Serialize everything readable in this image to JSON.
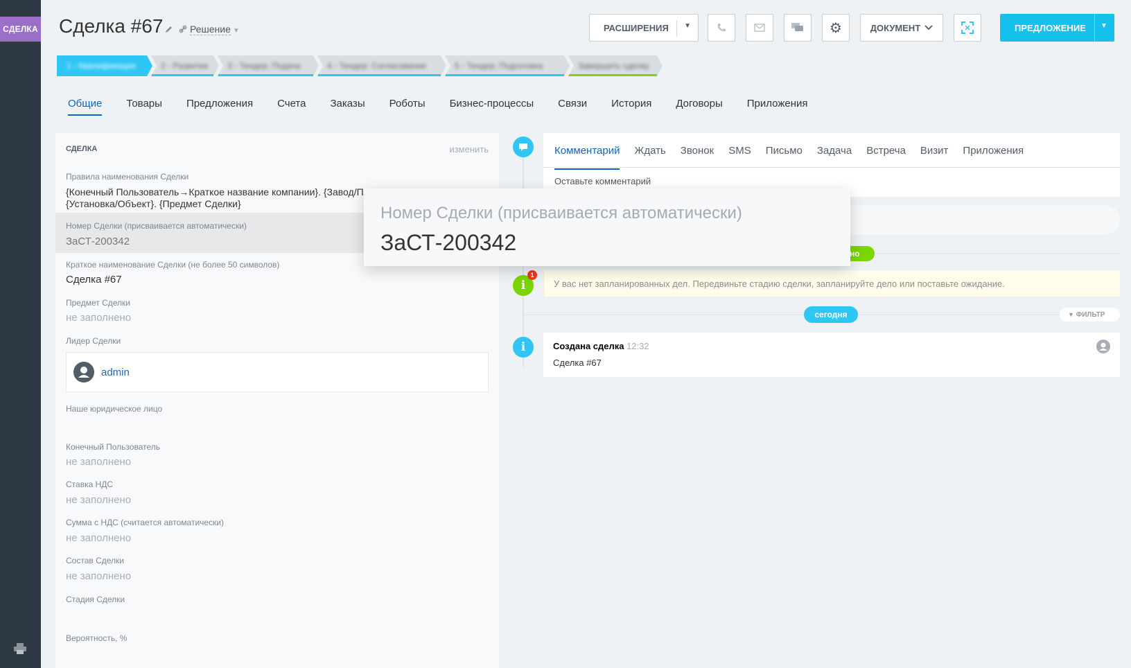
{
  "rail": {
    "tab_label": "СДЕЛКА"
  },
  "header": {
    "title": "Сделка  #67",
    "category": "Решение",
    "extensions_label": "РАСШИРЕНИЯ",
    "document_label": "ДОКУМЕНТ",
    "offer_label": "ПРЕДЛОЖЕНИЕ"
  },
  "stages": [
    {
      "label": "1 - Квалификация"
    },
    {
      "label": "2 - Развитие"
    },
    {
      "label": "3 - Тендер: Подача"
    },
    {
      "label": "4 - Тендер: Согласование"
    },
    {
      "label": "5 - Тендер: Подготовка"
    },
    {
      "label": "Завершить сделку"
    }
  ],
  "tabs": [
    "Общие",
    "Товары",
    "Предложения",
    "Счета",
    "Заказы",
    "Роботы",
    "Бизнес-процессы",
    "Связи",
    "История",
    "Договоры",
    "Приложения"
  ],
  "deal_card": {
    "heading": "СДЕЛКА",
    "edit_label": "изменить",
    "fields": [
      {
        "label": "Правила наименования Сделки",
        "value": "{Конечный Пользователь→Краткое название компании}. {Завод/Площадка/Цех}.",
        "value2": "{Установка/Объект}. {Предмет Сделки}"
      },
      {
        "label": "Номер Сделки (присваивается автоматически)",
        "value": "ЗаСТ-200342"
      },
      {
        "label": "Краткое наименование Сделки (не более 50 символов)",
        "value": "Сделка #67"
      },
      {
        "label": "Предмет Сделки",
        "value": "не заполнено"
      },
      {
        "label": "Лидер Сделки",
        "value": "admin"
      },
      {
        "label": "Наше юридическое лицо",
        "value": ""
      },
      {
        "label": "Конечный Пользователь",
        "value": "не заполнено"
      },
      {
        "label": "Ставка НДС",
        "value": "не заполнено"
      },
      {
        "label": "Сумма с НДС (считается автоматически)",
        "value": "не заполнено"
      },
      {
        "label": "Состав Сделки",
        "value": "не заполнено"
      },
      {
        "label": "Стадия Сделки",
        "value": ""
      },
      {
        "label": "Вероятность, %",
        "value": ""
      }
    ]
  },
  "timeline": {
    "editor_tabs": [
      "Комментарий",
      "Ждать",
      "Звонок",
      "SMS",
      "Письмо",
      "Задача",
      "Встреча",
      "Визит",
      "Приложения"
    ],
    "editor_placeholder": "Оставьте комментарий",
    "planned_badge": "но",
    "alert_count": "1",
    "warning": "У вас нет запланированных дел. Передвиньте стадию сделки, запланируйте дело или поставьте ожидание.",
    "today_label": "сегодня",
    "filter_label": "ФИЛЬТР",
    "event": {
      "title": "Создана сделка",
      "time": "12:32",
      "body": "Сделка #67"
    }
  },
  "zoom": {
    "label": "Номер Сделки (присваивается автоматически)",
    "value": "ЗаСТ-200342"
  },
  "colors": {
    "accent": "#2fc6f6",
    "link": "#0b66c3",
    "green": "#7bd500",
    "rail": "#2f3943",
    "rail_tab": "#9b6fc9"
  }
}
